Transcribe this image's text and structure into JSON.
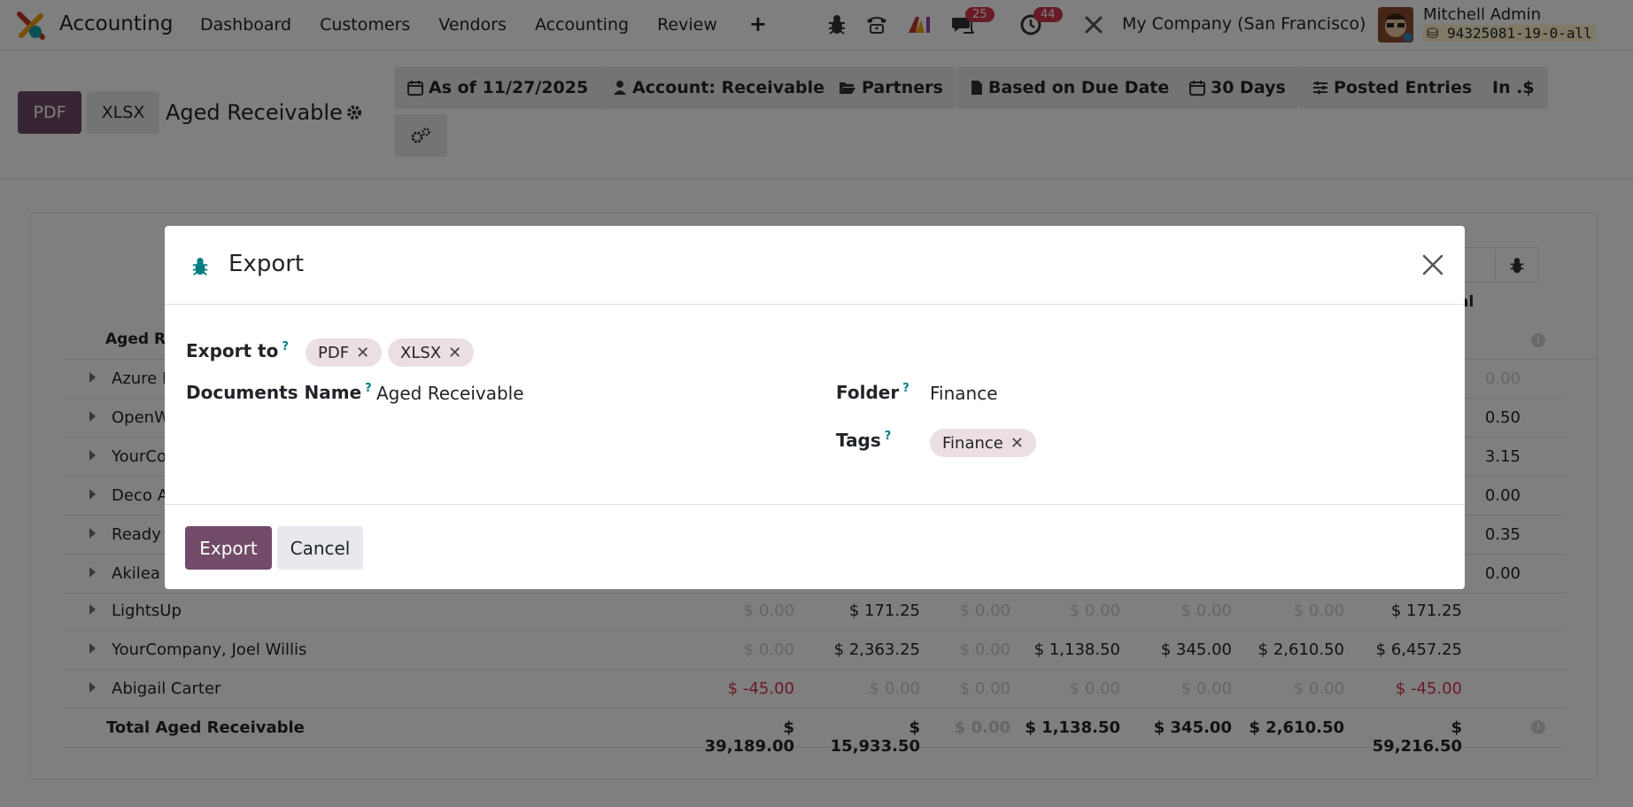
{
  "navbar": {
    "app_name": "Accounting",
    "menu": [
      "Dashboard",
      "Customers",
      "Vendors",
      "Accounting",
      "Review"
    ],
    "add_label": "+",
    "messages_count": "25",
    "activities_count": "44",
    "company": "My Company (San Francisco)",
    "user_name": "Mitchell Admin",
    "db_name": "94325081-19-0-all"
  },
  "control_panel": {
    "pdf_label": "PDF",
    "xlsx_label": "XLSX",
    "report_title": "Aged Receivable",
    "filters": [
      "As of 11/27/2025",
      "Account: Receivable",
      "Partners",
      "Based on Due Date",
      "30 Days",
      "Posted Entries",
      "In .$"
    ]
  },
  "report": {
    "header_title": "Aged Re",
    "total_header_fragment": "al",
    "rows": [
      {
        "name": "Azure I",
        "last": "0.00"
      },
      {
        "name": "OpenW",
        "last": "0.50"
      },
      {
        "name": "YourCo",
        "last": "3.15"
      },
      {
        "name": "Deco A",
        "last": "0.00"
      },
      {
        "name": "Ready I",
        "last": "0.35"
      },
      {
        "name": "Akilea",
        "last": "0.00"
      }
    ],
    "full_rows": [
      {
        "name": "LightsUp",
        "c1": "$ 0.00",
        "c2": "$ 171.25",
        "c3": "$ 0.00",
        "c4": "$ 0.00",
        "c5": "$ 0.00",
        "c6": "$ 0.00",
        "c7": "$ 171.25"
      },
      {
        "name": "YourCompany, Joel Willis",
        "c1": "$ 0.00",
        "c2": "$ 2,363.25",
        "c3": "$ 0.00",
        "c4": "$ 1,138.50",
        "c5": "$ 345.00",
        "c6": "$ 2,610.50",
        "c7": "$ 6,457.25"
      },
      {
        "name": "Abigail Carter",
        "c1": "$ -45.00",
        "c2": "$ 0.00",
        "c3": "$ 0.00",
        "c4": "$ 0.00",
        "c5": "$ 0.00",
        "c6": "$ 0.00",
        "c7": "$ -45.00"
      }
    ],
    "total": {
      "name": "Total Aged Receivable",
      "c1": "$ 39,189.00",
      "c2": "$ 15,933.50",
      "c3": "$ 0.00",
      "c4": "$ 1,138.50",
      "c5": "$ 345.00",
      "c6": "$ 2,610.50",
      "c7": "$ 59,216.50"
    }
  },
  "modal": {
    "title": "Export",
    "export_to_label": "Export to",
    "export_to_tags": [
      "PDF",
      "XLSX"
    ],
    "documents_name_label": "Documents Name",
    "documents_name_value": "Aged Receivable",
    "folder_label": "Folder",
    "folder_value": "Finance",
    "tags_label": "Tags",
    "tags": [
      "Finance"
    ],
    "help_mark": "?",
    "export_button": "Export",
    "cancel_button": "Cancel"
  },
  "colors": {
    "primary": "#714b67",
    "danger": "#d1344a",
    "tag_bg": "#ecdfe1"
  }
}
